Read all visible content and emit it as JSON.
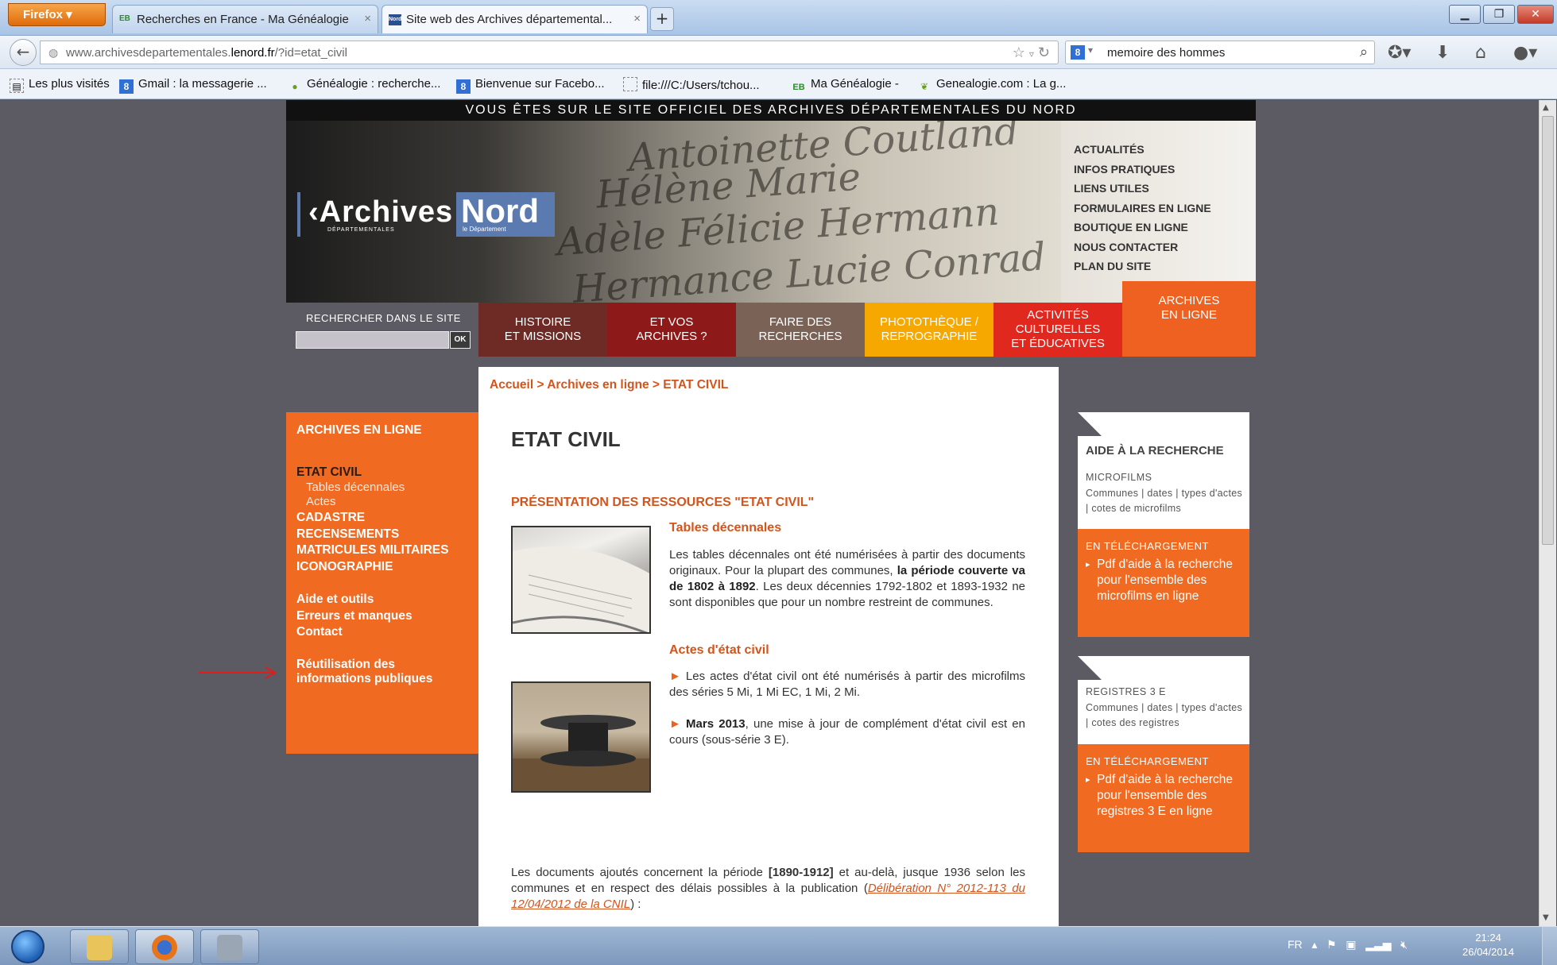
{
  "browser": {
    "menu_button": "Firefox",
    "tabs": [
      {
        "favicon": "EB",
        "title": "Recherches en France - Ma Généalogie"
      },
      {
        "favicon": "Nord",
        "title": "Site web des Archives départemental..."
      }
    ],
    "new_tab": "+",
    "url_prefix": "www.archivesdepartementales.",
    "url_domain": "lenord.fr",
    "url_suffix": "/?id=etat_civil",
    "search_engine": "8",
    "search_value": "memoire des hommes",
    "bookmarks": [
      {
        "icon": "page-icon",
        "label": "Les plus visités"
      },
      {
        "icon": "8",
        "label": "Gmail : la messagerie ..."
      },
      {
        "icon": "green-icon",
        "label": "Généalogie : recherche..."
      },
      {
        "icon": "8",
        "label": "Bienvenue sur Facebo..."
      },
      {
        "icon": "blank-page-icon",
        "label": "file:///C:/Users/tchou..."
      },
      {
        "icon": "EB",
        "label": "Ma Généalogie -"
      },
      {
        "icon": "leaf-icon",
        "label": "Genealogie.com : La g..."
      }
    ]
  },
  "site": {
    "official_bar": "VOUS ÊTES SUR LE SITE OFFICIEL DES ARCHIVES DÉPARTEMENTALES DU NORD",
    "logo": {
      "text": "Archives",
      "sub": "DÉPARTEMENTALES",
      "nord": "Nord",
      "nord_sub": "le Département"
    },
    "top_links": [
      "ACTUALITÉS",
      "INFOS PRATIQUES",
      "LIENS UTILES",
      "FORMULAIRES EN LIGNE",
      "BOUTIQUE EN LIGNE",
      "NOUS CONTACTER",
      "PLAN DU SITE"
    ],
    "search_label": "RECHERCHER DANS LE SITE",
    "search_button": "OK",
    "main_nav": [
      {
        "line1": "HISTOIRE",
        "line2": "ET MISSIONS",
        "color": "#6e2a25"
      },
      {
        "line1": "ET VOS",
        "line2": "ARCHIVES ?",
        "color": "#8e1919"
      },
      {
        "line1": "FAIRE DES",
        "line2": "RECHERCHES",
        "color": "#7a6256"
      },
      {
        "line1": "PHOTOTHÈQUE /",
        "line2": "REPROGRAPHIE",
        "color": "#f6a800"
      },
      {
        "line1": "ACTIVITÉS",
        "line2": "CULTURELLES",
        "line3": "ET ÉDUCATIVES",
        "color": "#e0281e"
      },
      {
        "line1": "ARCHIVES",
        "line2": "EN LIGNE",
        "color": "#ef6120"
      }
    ],
    "left_nav": {
      "heading": "ARCHIVES EN LIGNE",
      "etat_civil": "ETAT CIVIL",
      "tables": "Tables décennales",
      "actes": "Actes",
      "cadastre": "CADASTRE",
      "recensements": "RECENSEMENTS",
      "matricules": "MATRICULES MILITAIRES",
      "iconographie": "ICONOGRAPHIE",
      "aide": "Aide et outils",
      "erreurs": "Erreurs et manques",
      "contact": "Contact",
      "reutilisation1": "Réutilisation des",
      "reutilisation2": "informations publiques"
    },
    "breadcrumb": {
      "home": "Accueil",
      "sep1": " > ",
      "section": "Archives en ligne",
      "sep2": " > ",
      "current": "ETAT CIVIL"
    },
    "page_title": "ETAT CIVIL",
    "section_title": "PRÉSENTATION DES RESSOURCES \"ETAT CIVIL\"",
    "tables": {
      "title": "Tables décennales",
      "text_a": "Les tables décennales ont été numérisées à partir des documents originaux. Pour la plupart des communes, ",
      "text_bold": "la période couverte va de 1802 à 1892",
      "text_b": ". Les deux décennies 1792-1802 et 1893-1932 ne sont disponibles que pour un nombre restreint de communes."
    },
    "actes": {
      "title": "Actes d'état civil",
      "p1": " Les actes d'état civil ont été numérisés à partir des microfilms des séries 5 Mi, 1 Mi EC, 1 Mi, 2 Mi.",
      "p2_bold": "Mars 2013",
      "p2": ", une mise à jour de complément d'état civil est en cours (sous-série 3 E).",
      "bullet": "►"
    },
    "footer_para": {
      "a": "Les documents ajoutés concernent la période ",
      "bold": "[1890-1912]",
      "b": " et au-delà, jusque 1936 selon les communes et en respect des délais possibles à la publication (",
      "link": "Délibération N° 2012-113 du 12/04/2012 de la CNIL",
      "c": ") :"
    },
    "right_sidebar": {
      "title": "AIDE À LA RECHERCHE",
      "box1_label": "MICROFILMS",
      "box1_links": "Communes | dates | types d'actes | cotes de microfilms",
      "box1_dl_head": "EN TÉLÉCHARGEMENT",
      "box1_dl_text": "Pdf d'aide à la recherche pour l'ensemble des microfilms en ligne",
      "box2_label": "REGISTRES 3 E",
      "box2_links": "Communes | dates | types d'actes | cotes des registres",
      "box2_dl_head": "EN TÉLÉCHARGEMENT",
      "box2_dl_text": "Pdf d'aide à la recherche pour l'ensemble des registres 3 E en ligne"
    }
  },
  "taskbar": {
    "lang": "FR",
    "time": "21:24",
    "date": "26/04/2014"
  },
  "colors": {
    "accent_orange": "#f06a21",
    "link_orange": "#d3541c",
    "site_bg": "#5c5a62"
  }
}
